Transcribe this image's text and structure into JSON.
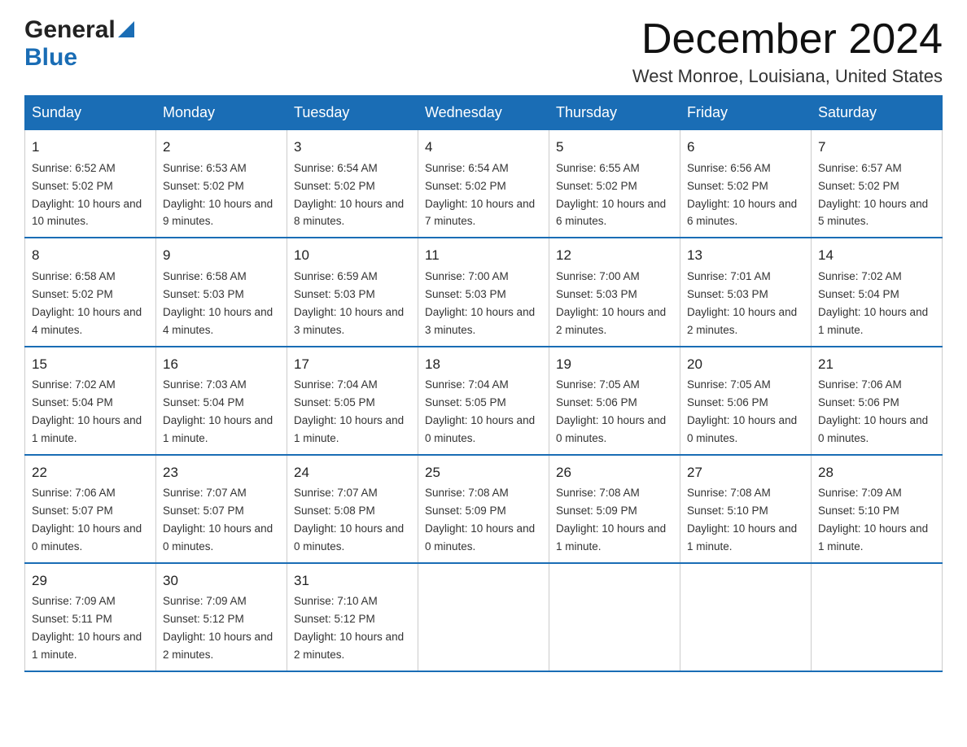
{
  "logo": {
    "text1": "General",
    "text2": "Blue"
  },
  "header": {
    "month": "December 2024",
    "location": "West Monroe, Louisiana, United States"
  },
  "weekdays": [
    "Sunday",
    "Monday",
    "Tuesday",
    "Wednesday",
    "Thursday",
    "Friday",
    "Saturday"
  ],
  "weeks": [
    [
      {
        "day": "1",
        "sunrise": "6:52 AM",
        "sunset": "5:02 PM",
        "daylight": "10 hours and 10 minutes."
      },
      {
        "day": "2",
        "sunrise": "6:53 AM",
        "sunset": "5:02 PM",
        "daylight": "10 hours and 9 minutes."
      },
      {
        "day": "3",
        "sunrise": "6:54 AM",
        "sunset": "5:02 PM",
        "daylight": "10 hours and 8 minutes."
      },
      {
        "day": "4",
        "sunrise": "6:54 AM",
        "sunset": "5:02 PM",
        "daylight": "10 hours and 7 minutes."
      },
      {
        "day": "5",
        "sunrise": "6:55 AM",
        "sunset": "5:02 PM",
        "daylight": "10 hours and 6 minutes."
      },
      {
        "day": "6",
        "sunrise": "6:56 AM",
        "sunset": "5:02 PM",
        "daylight": "10 hours and 6 minutes."
      },
      {
        "day": "7",
        "sunrise": "6:57 AM",
        "sunset": "5:02 PM",
        "daylight": "10 hours and 5 minutes."
      }
    ],
    [
      {
        "day": "8",
        "sunrise": "6:58 AM",
        "sunset": "5:02 PM",
        "daylight": "10 hours and 4 minutes."
      },
      {
        "day": "9",
        "sunrise": "6:58 AM",
        "sunset": "5:03 PM",
        "daylight": "10 hours and 4 minutes."
      },
      {
        "day": "10",
        "sunrise": "6:59 AM",
        "sunset": "5:03 PM",
        "daylight": "10 hours and 3 minutes."
      },
      {
        "day": "11",
        "sunrise": "7:00 AM",
        "sunset": "5:03 PM",
        "daylight": "10 hours and 3 minutes."
      },
      {
        "day": "12",
        "sunrise": "7:00 AM",
        "sunset": "5:03 PM",
        "daylight": "10 hours and 2 minutes."
      },
      {
        "day": "13",
        "sunrise": "7:01 AM",
        "sunset": "5:03 PM",
        "daylight": "10 hours and 2 minutes."
      },
      {
        "day": "14",
        "sunrise": "7:02 AM",
        "sunset": "5:04 PM",
        "daylight": "10 hours and 1 minute."
      }
    ],
    [
      {
        "day": "15",
        "sunrise": "7:02 AM",
        "sunset": "5:04 PM",
        "daylight": "10 hours and 1 minute."
      },
      {
        "day": "16",
        "sunrise": "7:03 AM",
        "sunset": "5:04 PM",
        "daylight": "10 hours and 1 minute."
      },
      {
        "day": "17",
        "sunrise": "7:04 AM",
        "sunset": "5:05 PM",
        "daylight": "10 hours and 1 minute."
      },
      {
        "day": "18",
        "sunrise": "7:04 AM",
        "sunset": "5:05 PM",
        "daylight": "10 hours and 0 minutes."
      },
      {
        "day": "19",
        "sunrise": "7:05 AM",
        "sunset": "5:06 PM",
        "daylight": "10 hours and 0 minutes."
      },
      {
        "day": "20",
        "sunrise": "7:05 AM",
        "sunset": "5:06 PM",
        "daylight": "10 hours and 0 minutes."
      },
      {
        "day": "21",
        "sunrise": "7:06 AM",
        "sunset": "5:06 PM",
        "daylight": "10 hours and 0 minutes."
      }
    ],
    [
      {
        "day": "22",
        "sunrise": "7:06 AM",
        "sunset": "5:07 PM",
        "daylight": "10 hours and 0 minutes."
      },
      {
        "day": "23",
        "sunrise": "7:07 AM",
        "sunset": "5:07 PM",
        "daylight": "10 hours and 0 minutes."
      },
      {
        "day": "24",
        "sunrise": "7:07 AM",
        "sunset": "5:08 PM",
        "daylight": "10 hours and 0 minutes."
      },
      {
        "day": "25",
        "sunrise": "7:08 AM",
        "sunset": "5:09 PM",
        "daylight": "10 hours and 0 minutes."
      },
      {
        "day": "26",
        "sunrise": "7:08 AM",
        "sunset": "5:09 PM",
        "daylight": "10 hours and 1 minute."
      },
      {
        "day": "27",
        "sunrise": "7:08 AM",
        "sunset": "5:10 PM",
        "daylight": "10 hours and 1 minute."
      },
      {
        "day": "28",
        "sunrise": "7:09 AM",
        "sunset": "5:10 PM",
        "daylight": "10 hours and 1 minute."
      }
    ],
    [
      {
        "day": "29",
        "sunrise": "7:09 AM",
        "sunset": "5:11 PM",
        "daylight": "10 hours and 1 minute."
      },
      {
        "day": "30",
        "sunrise": "7:09 AM",
        "sunset": "5:12 PM",
        "daylight": "10 hours and 2 minutes."
      },
      {
        "day": "31",
        "sunrise": "7:10 AM",
        "sunset": "5:12 PM",
        "daylight": "10 hours and 2 minutes."
      },
      null,
      null,
      null,
      null
    ]
  ]
}
